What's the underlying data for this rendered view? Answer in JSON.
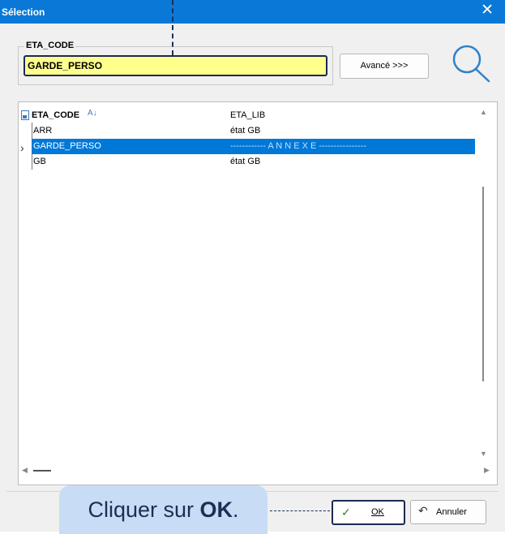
{
  "window": {
    "title": "Sélection"
  },
  "filter": {
    "group_label": "ETA_CODE",
    "value": "GARDE_PERSO",
    "advanced_label": "Avancé >>>"
  },
  "list": {
    "columns": [
      "ETA_CODE",
      "ETA_LIB"
    ],
    "rows": [
      {
        "code": "ARR",
        "lib": "état GB"
      },
      {
        "code": "GARDE_PERSO",
        "lib": "------------ A N N E X E ----------------"
      },
      {
        "code": "GB",
        "lib": "état GB"
      }
    ],
    "selected_index": 1
  },
  "callout": {
    "text_before": "Cliquer sur ",
    "text_bold": "OK",
    "text_after": "."
  },
  "buttons": {
    "ok_label": "OK",
    "cancel_label": "Annuler"
  },
  "colors": {
    "title_bar": "#0a78d7",
    "selection": "#0078d7",
    "input_bg": "#ffff8c",
    "callout_bg": "#c8dcf5"
  }
}
